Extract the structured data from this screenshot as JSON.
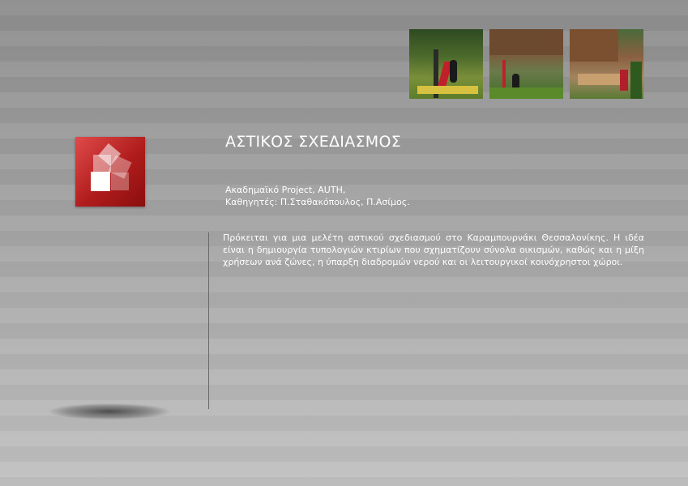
{
  "title": "ΑΣΤΙΚΟΣ ΣΧΕΔΙΑΣΜΟΣ",
  "subtitle_line1": "Ακαδημαϊκό Project, AUTH,",
  "subtitle_line2": "Καθηγητές: Π.Σταθακόπουλος, Π.Ασίμος.",
  "description": "Πρόκειται για μια μελέτη αστικού σχεδιασμού στο Καραμπουρνάκι Θεσσαλονίκης. Η ιδέα είναι η δημιουργία τυπολογιών κτιρίων που σχηματίζουν σύνολα οικισμών, καθώς και η μίξη χρήσεων ανά ζώνες, η ύπαρξη διαδρομών νερού και οι λειτουργικοί κοινόχρηστοι χώροι.",
  "colors": {
    "logo_red": "#b01c1c",
    "text": "#ffffff"
  },
  "icons": [
    "project-logo-icon"
  ]
}
